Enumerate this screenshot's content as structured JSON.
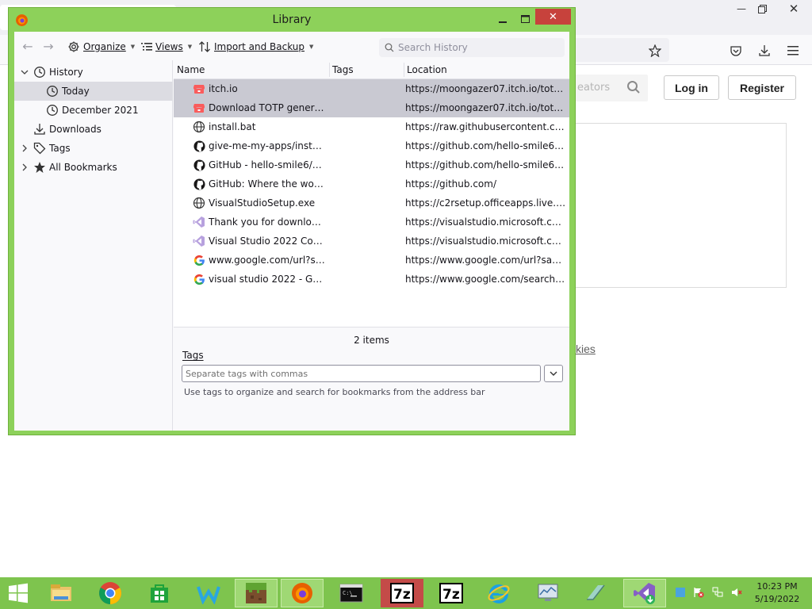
{
  "library": {
    "title": "Library",
    "toolbar": {
      "organize": "Organize",
      "views": "Views",
      "import_backup": "Import and Backup",
      "search_placeholder": "Search History"
    },
    "sidebar": [
      {
        "label": "History",
        "level": 0,
        "expanded": true,
        "icon": "history-clock-icon"
      },
      {
        "label": "Today",
        "level": 1,
        "selected": true,
        "icon": "clock-icon"
      },
      {
        "label": "December 2021",
        "level": 1,
        "icon": "clock-icon"
      },
      {
        "label": "Downloads",
        "level": 0,
        "icon": "download-arrow-icon"
      },
      {
        "label": "Tags",
        "level": 0,
        "collapsed": true,
        "icon": "tag-icon"
      },
      {
        "label": "All Bookmarks",
        "level": 0,
        "collapsed": true,
        "icon": "star-icon"
      }
    ],
    "columns": {
      "name": "Name",
      "tags": "Tags",
      "location": "Location"
    },
    "rows": [
      {
        "name": "itch.io",
        "location": "https://moongazer07.itch.io/totp-ge...",
        "icon": "itchio-icon",
        "selected": true
      },
      {
        "name": "Download TOTP generato...",
        "location": "https://moongazer07.itch.io/totp-ge...",
        "icon": "itchio-icon",
        "selected": true
      },
      {
        "name": "install.bat",
        "location": "https://raw.githubusercontent.com/...",
        "icon": "globe-icon"
      },
      {
        "name": "give-me-my-apps/install....",
        "location": "https://github.com/hello-smile6/giv...",
        "icon": "github-icon"
      },
      {
        "name": "GitHub - hello-smile6/giv...",
        "location": "https://github.com/hello-smile6/giv...",
        "icon": "github-icon"
      },
      {
        "name": "GitHub: Where the world ...",
        "location": "https://github.com/",
        "icon": "github-icon"
      },
      {
        "name": "VisualStudioSetup.exe",
        "location": "https://c2rsetup.officeapps.live.com/...",
        "icon": "globe-icon"
      },
      {
        "name": "Thank you for downloadin...",
        "location": "https://visualstudio.microsoft.com/t...",
        "icon": "visual-studio-icon"
      },
      {
        "name": "Visual Studio 2022 Comm...",
        "location": "https://visualstudio.microsoft.com/v...",
        "icon": "visual-studio-icon"
      },
      {
        "name": "www.google.com/url?sa=...",
        "location": "https://www.google.com/url?sa=t&r...",
        "icon": "google-icon"
      },
      {
        "name": "visual studio 2022 - Googl...",
        "location": "https://www.google.com/search?clie...",
        "icon": "google-icon"
      }
    ],
    "details": {
      "count": "2 items",
      "tags_label": "Tags",
      "tags_placeholder": "Separate tags with commas",
      "hint": "Use tags to organize and search for bookmarks from the address bar"
    }
  },
  "background_page": {
    "search_placeholder": "eators",
    "login": "Log in",
    "register": "Register",
    "link_fragment": "kies"
  },
  "taskbar": {
    "time": "10:23 PM",
    "date": "5/19/2022",
    "apps": [
      "start-icon",
      "file-explorer-icon",
      "chrome-icon",
      "store-icon",
      "app-icon",
      "minecraft-icon",
      "firefox-icon",
      "cmd-icon",
      "7zip-icon",
      "7zip-icon",
      "internet-explorer-icon",
      "monitor-icon",
      "app-icon",
      "visual-studio-installer-icon"
    ]
  },
  "colors": {
    "window_frame": "#8dd15a",
    "taskbar": "#7ec44e",
    "close_button": "#c7423c",
    "selection": "#c9c9d2"
  }
}
